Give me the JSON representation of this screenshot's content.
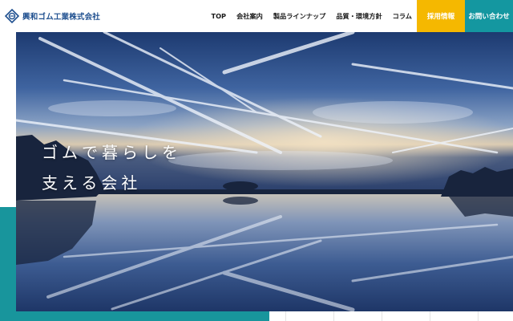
{
  "header": {
    "logo": {
      "icon": "company-logo-mark",
      "text": "興和ゴム工業株式会社"
    },
    "nav": [
      {
        "label": "TOP"
      },
      {
        "label": "会社案内"
      },
      {
        "label": "製品ラインナップ"
      },
      {
        "label": "品質・環境方針"
      },
      {
        "label": "コラム"
      }
    ],
    "recruit_label": "採用情報",
    "contact_label": "お問い合わせ"
  },
  "hero": {
    "line1": "ゴムで暮らしを",
    "line2": "支える会社"
  },
  "colors": {
    "brand_blue": "#1e4f8f",
    "recruit_yellow": "#f5b800",
    "contact_teal": "#1497a0",
    "accent_teal": "#18959c"
  }
}
